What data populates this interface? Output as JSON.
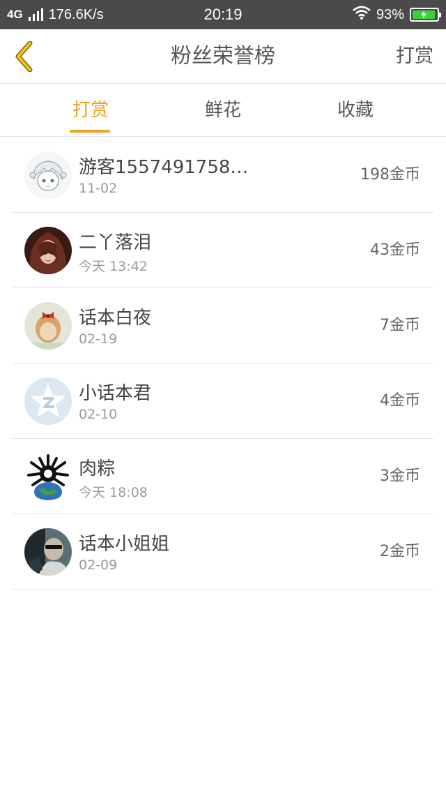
{
  "status_bar": {
    "network": "4G",
    "speed": "176.6K/s",
    "time": "20:19",
    "battery": "93%",
    "battery_level": 0.93,
    "battery_color": "#3cd13c"
  },
  "header": {
    "title": "粉丝荣誉榜",
    "action_label": "打赏",
    "accent_color": "#f0a01e"
  },
  "tabs": [
    {
      "label": "打赏",
      "active": true
    },
    {
      "label": "鲜花",
      "active": false
    },
    {
      "label": "收藏",
      "active": false
    }
  ],
  "rows": [
    {
      "name": "游客1557491758…",
      "date": "11-02",
      "amount": "198金币",
      "avatar": "anime-girl-sketch-avatar"
    },
    {
      "name": "二丫落泪",
      "date": "今天 13:42",
      "amount": "43金币",
      "avatar": "anime-portrait-avatar"
    },
    {
      "name": "话本白夜",
      "date": "02-19",
      "amount": "7金币",
      "avatar": "child-with-bow-avatar"
    },
    {
      "name": "小话本君",
      "date": "02-10",
      "amount": "4金币",
      "avatar": "star-logo-avatar"
    },
    {
      "name": "肉粽",
      "date": "今天 18:08",
      "amount": "3金币",
      "avatar": "creature-on-globe-avatar"
    },
    {
      "name": "话本小姐姐",
      "date": "02-09",
      "amount": "2金币",
      "avatar": "person-sunglasses-avatar"
    }
  ]
}
